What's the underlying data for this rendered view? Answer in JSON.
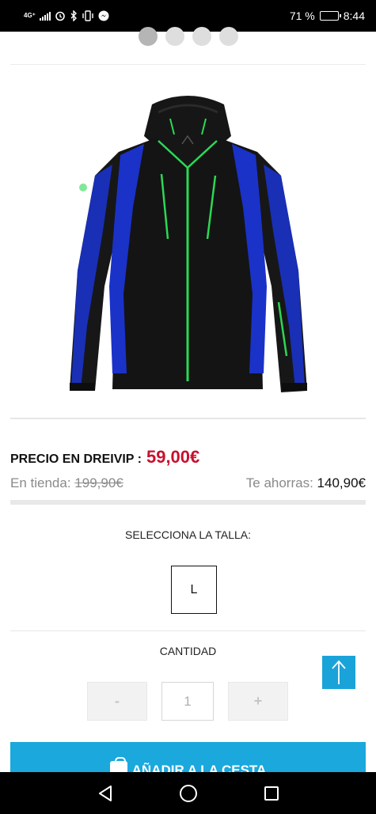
{
  "status_bar": {
    "network": "4G⁺",
    "battery_text": "71 %",
    "battery_level": 0.71,
    "time": "8:44"
  },
  "carousel": {
    "total": 4,
    "active": 1
  },
  "product": {
    "image_icon": "jacket-photo",
    "colors": {
      "body": "#151515",
      "panel": "#1a32c8",
      "zip": "#2bd955"
    }
  },
  "price": {
    "label": "PRECIO EN DREIVIP :",
    "value": "59,00€",
    "store_label": "En tienda:",
    "store_price": "199,90€",
    "save_label": "Te ahorras:",
    "save_value": "140,90€"
  },
  "size": {
    "title": "SELECCIONA LA TALLA:",
    "options": [
      "L"
    ]
  },
  "quantity": {
    "title": "CANTIDAD",
    "minus": "-",
    "value": "1",
    "plus": "+"
  },
  "cart": {
    "label": "AÑADIR A LA CESTA",
    "icon": "shopping-bag-icon"
  },
  "colors": {
    "accent": "#1aa8dd",
    "price_red": "#c8102e"
  }
}
